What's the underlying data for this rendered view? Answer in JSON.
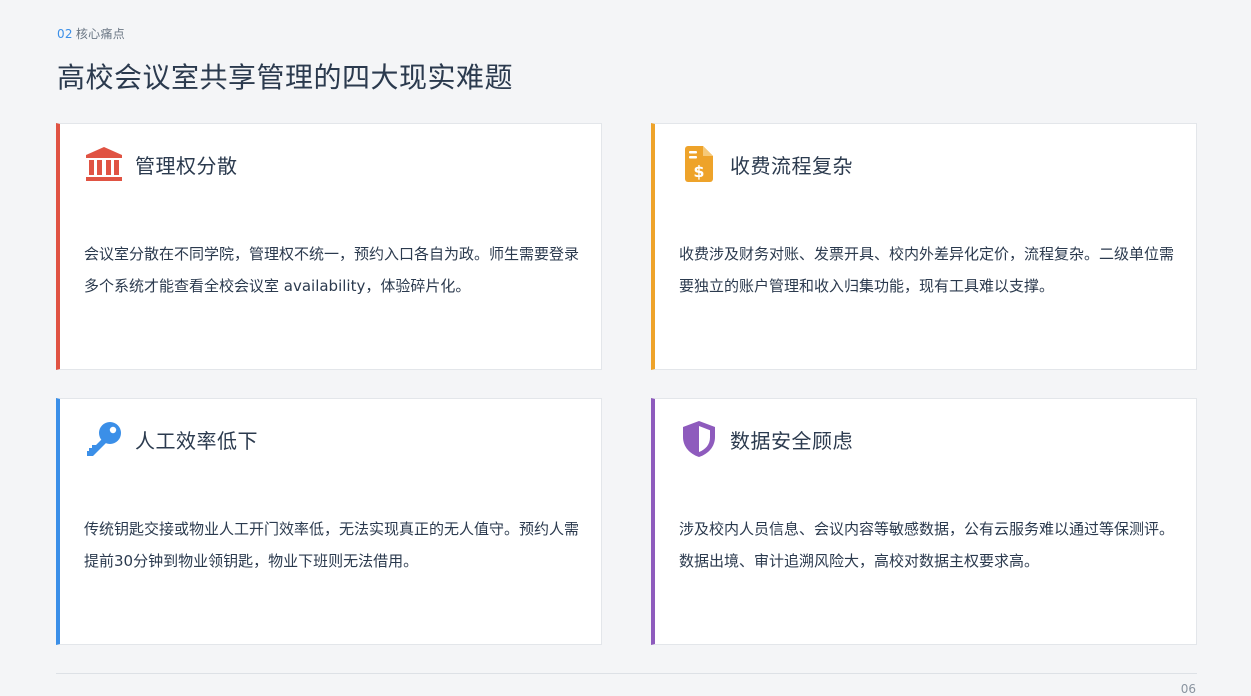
{
  "header": {
    "section_number": "02",
    "section_label": "核心痛点",
    "title": "高校会议室共享管理的四大现实难题"
  },
  "cards": [
    {
      "icon": "bank-icon",
      "accent": "#e05343",
      "title": "管理权分散",
      "body": "会议室分散在不同学院，管理权不统一，预约入口各自为政。师生需要登录多个系统才能查看全校会议室 availability，体验碎片化。"
    },
    {
      "icon": "invoice-dollar-icon",
      "accent": "#eea32a",
      "title": "收费流程复杂",
      "body": "收费涉及财务对账、发票开具、校内外差异化定价，流程复杂。二级单位需要独立的账户管理和收入归集功能，现有工具难以支撑。"
    },
    {
      "icon": "key-icon",
      "accent": "#3b8fe8",
      "title": "人工效率低下",
      "body": "传统钥匙交接或物业人工开门效率低，无法实现真正的无人值守。预约人需提前30分钟到物业领钥匙，物业下班则无法借用。"
    },
    {
      "icon": "shield-icon",
      "accent": "#8e5bbd",
      "title": "数据安全顾虑",
      "body": "涉及校内人员信息、会议内容等敏感数据，公有云服务难以通过等保测评。数据出境、审计追溯风险大，高校对数据主权要求高。"
    }
  ],
  "footer": {
    "page_number": "06"
  }
}
